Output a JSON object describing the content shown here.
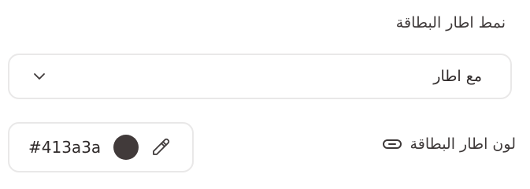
{
  "card_style": {
    "label": "نمط اطار البطاقة",
    "selected": "مع اطار",
    "dropdown_icon": "chevron-down-icon"
  },
  "border_color": {
    "label": "لون اطار البطاقة",
    "label_icon": "link-icon",
    "hex": "#413a3a",
    "swatch": "#413a3a",
    "picker_icon": "eyedropper-icon"
  }
}
